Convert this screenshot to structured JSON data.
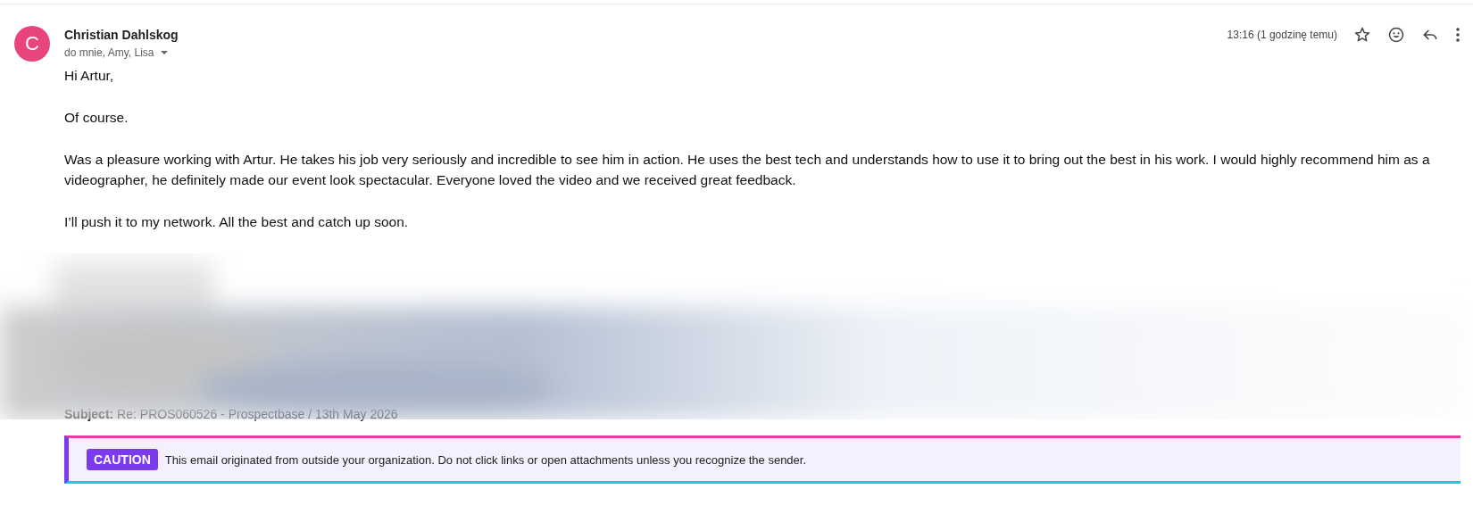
{
  "sender": {
    "initial": "C",
    "name": "Christian Dahlskog",
    "recipients": "do mnie, Amy, Lisa"
  },
  "meta": {
    "time": "13:16 (1 godzinę temu)",
    "starred": false
  },
  "body": [
    "Hi Artur,",
    "Of course.",
    "Was a pleasure working with Artur. He takes his job very seriously and incredible to see him in action. He uses the best tech and understands how to use it to bring out the best in his work. I would highly recommend him as a videographer, he definitely made our event look spectacular. Everyone loved the video and we received great feedback.",
    "I’ll push it to my network. All the best and catch up soon."
  ],
  "quoted": {
    "subject": "**Subject:** Re: PROS060526 - Prospectbase / 13th May 2026"
  },
  "banner": {
    "tag": "CAUTION",
    "text": "This email originated from outside your organization. Do not click links or open attachments unless you recognize the sender."
  }
}
